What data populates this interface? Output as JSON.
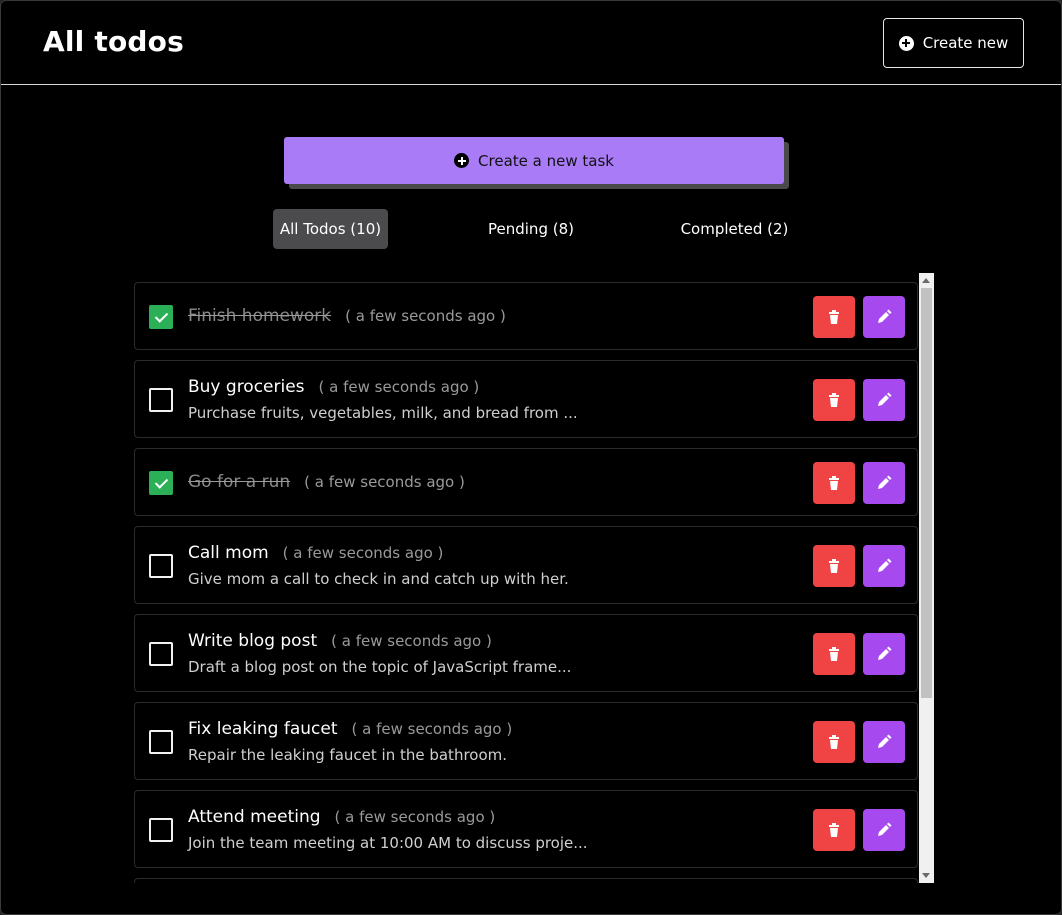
{
  "header": {
    "title": "All todos",
    "create_new_label": "Create new"
  },
  "main": {
    "create_task_label": "Create a new task"
  },
  "tabs": [
    {
      "label": "All Todos (10)",
      "active": true
    },
    {
      "label": "Pending (8)",
      "active": false
    },
    {
      "label": "Completed (2)",
      "active": false
    }
  ],
  "todos": [
    {
      "title": "Finish homework",
      "time": "( a few seconds ago )",
      "description": "",
      "completed": true
    },
    {
      "title": "Buy groceries",
      "time": "( a few seconds ago )",
      "description": "Purchase fruits, vegetables, milk, and bread from ...",
      "completed": false
    },
    {
      "title": "Go for a run",
      "time": "( a few seconds ago )",
      "description": "",
      "completed": true
    },
    {
      "title": "Call mom",
      "time": "( a few seconds ago )",
      "description": "Give mom a call to check in and catch up with her.",
      "completed": false
    },
    {
      "title": "Write blog post",
      "time": "( a few seconds ago )",
      "description": "Draft a blog post on the topic of JavaScript frame...",
      "completed": false
    },
    {
      "title": "Fix leaking faucet",
      "time": "( a few seconds ago )",
      "description": "Repair the leaking faucet in the bathroom.",
      "completed": false
    },
    {
      "title": "Attend meeting",
      "time": "( a few seconds ago )",
      "description": "Join the team meeting at 10:00 AM to discuss proje...",
      "completed": false
    }
  ],
  "colors": {
    "accent_purple": "#a97bf7",
    "edit_purple": "#a64af0",
    "delete_red": "#f04444",
    "check_green": "#2bb057"
  },
  "icons": {
    "create_new": "plus-circle-icon",
    "create_task": "plus-circle-icon",
    "delete": "trash-icon",
    "edit": "pencil-icon",
    "check": "check-icon"
  }
}
